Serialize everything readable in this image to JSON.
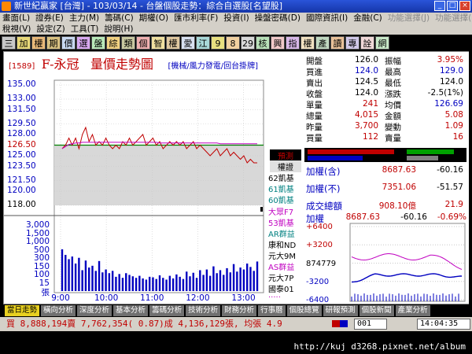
{
  "window": {
    "title": "新世紀贏家 [台灣] - 103/03/14 - 台盤個股走勢：綜合自選股[名望股]"
  },
  "menu": {
    "row1": [
      "畫面(L)",
      "證券(E)",
      "主力(M)",
      "籌碼(C)",
      "期權(O)",
      "匯市利率(F)",
      "投資(I)",
      "操盤密碼(D)",
      "國際資訊(I)",
      "金融(C)",
      "功能選擇(J)",
      "功能選擇(K)"
    ],
    "row2": [
      "稅視(V)",
      "設定(Z)",
      "工具(T)",
      "說明(H)"
    ]
  },
  "toolbar": [
    {
      "t": "三",
      "c": "#c8c8c8"
    },
    {
      "t": "加",
      "c": "#e8d878"
    },
    {
      "t": "權",
      "c": "#e8b878"
    },
    {
      "t": "期",
      "c": "#d8c080"
    },
    {
      "t": "價",
      "c": "#c8d8f0"
    },
    {
      "t": "選",
      "c": "#d8a8f0"
    },
    {
      "t": "盤",
      "c": "#b8e8b8"
    },
    {
      "t": "綜",
      "c": "#f0d080"
    },
    {
      "t": "類",
      "c": "#c8c8a0"
    },
    {
      "t": "個",
      "c": "#f0b0b0"
    },
    {
      "t": "智",
      "c": "#f0e0a0"
    },
    {
      "t": "權",
      "c": "#e0c8a0"
    },
    {
      "t": "愛",
      "c": "#d8e0f0"
    },
    {
      "t": "江",
      "c": "#a8d8d8"
    },
    {
      "t": "9",
      "c": "#e8e080"
    },
    {
      "t": "8",
      "c": "#f0d0a0"
    },
    {
      "t": "29",
      "c": "#d8d8d8"
    },
    {
      "t": "核",
      "c": "#b8e0b8"
    },
    {
      "t": "興",
      "c": "#f0c8c8"
    },
    {
      "t": "指",
      "c": "#d8b8e8"
    },
    {
      "t": "權",
      "c": "#f0e0c0"
    },
    {
      "t": "產",
      "c": "#c0d8c0"
    },
    {
      "t": "讀",
      "c": "#e8c098"
    },
    {
      "t": "專",
      "c": "#d0c8e8"
    },
    {
      "t": "詮",
      "c": "#f0d8d8"
    },
    {
      "t": "網",
      "c": "#c8e8c8"
    }
  ],
  "header": {
    "code": "[1589]",
    "name": "F-永冠",
    "title": "量價走勢圖",
    "modes": "[機械/風力發電/回台掛牌]"
  },
  "price_axis": [
    "135.00",
    "133.00",
    "131.50",
    "129.50",
    "128.00",
    "126.50",
    "125.00",
    "123.50",
    "121.50",
    "120.00",
    "118.00"
  ],
  "volume_axis": [
    "3,000",
    "1,500",
    "1,000",
    "500",
    "300",
    "150",
    "100",
    "15",
    "張"
  ],
  "time_axis": [
    "9:00",
    "10:00",
    "11:00",
    "12:00",
    "13:00"
  ],
  "brokers": [
    {
      "t": "預測",
      "c": "#c00000",
      "bg": "#000"
    },
    {
      "t": "權證",
      "c": "#000",
      "bg": "#e0e0e0"
    },
    {
      "t": "62凱基",
      "c": "#000"
    },
    {
      "t": "61凱基",
      "c": "#008080"
    },
    {
      "t": "60凱基",
      "c": "#008080"
    },
    {
      "t": "大眾F7",
      "c": "#c000c0"
    },
    {
      "t": "53凱基",
      "c": "#c000c0"
    },
    {
      "t": "AR群益",
      "c": "#008080"
    },
    {
      "t": "康和ND",
      "c": "#000"
    },
    {
      "t": "元大9M",
      "c": "#000"
    },
    {
      "t": "AS群益",
      "c": "#c000c0"
    },
    {
      "t": "元大7P",
      "c": "#000"
    },
    {
      "t": "國泰01",
      "c": "#000"
    },
    {
      "t": "·····",
      "c": "#c000c0"
    }
  ],
  "quote": [
    {
      "l1": "開盤",
      "v1": "126.0",
      "c1": "#000",
      "l2": "振幅",
      "v2": "3.95%",
      "c2": "#c00000"
    },
    {
      "l1": "買進",
      "v1": "124.0",
      "c1": "#0000c0",
      "l2": "最高",
      "v2": "129.0",
      "c2": "#0000c0"
    },
    {
      "l1": "賣出",
      "v1": "124.5",
      "c1": "#000",
      "l2": "最低",
      "v2": "124.0",
      "c2": "#000"
    },
    {
      "l1": "收盤",
      "v1": "124.0",
      "c1": "#000",
      "l2": "漲跌",
      "v2": "-2.5(1%)",
      "c2": "#000"
    },
    {
      "l1": "單量",
      "v1": "241",
      "c1": "#c00000",
      "l2": "均價",
      "v2": "126.69",
      "c2": "#0000c0"
    },
    {
      "l1": "總量",
      "v1": "4,015",
      "c1": "#c00000",
      "l2": "金額",
      "v2": "5.08",
      "c2": "#c00000"
    },
    {
      "l1": "昨量",
      "v1": "3,700",
      "c1": "#c00000",
      "l2": "變動",
      "v2": "1.09",
      "c2": "#c00000"
    },
    {
      "l1": "買量",
      "v1": "112",
      "c1": "#c00000",
      "l2": "賣量",
      "v2": "16",
      "c2": "#c00000"
    }
  ],
  "market": [
    {
      "l": "加權(含)",
      "v": "8687.63",
      "d": "-60.16"
    },
    {
      "l": "加權(不)",
      "v": "7351.06",
      "d": "-51.57"
    },
    {
      "l": "成交總額",
      "v": "908.10億",
      "d": "21.9"
    }
  ],
  "mini": {
    "label": "加權",
    "value": "8687.63",
    "change": "-60.16",
    "pct": "-0.69%",
    "axis": [
      "+6400",
      "+3200",
      "874779",
      "-3200",
      "-6400"
    ]
  },
  "tabs": [
    {
      "t": "當日走勢",
      "active": true
    },
    {
      "t": "橫向分析"
    },
    {
      "t": "深度分析"
    },
    {
      "t": "基本分析"
    },
    {
      "t": "籌碼分析"
    },
    {
      "t": "技術分析"
    },
    {
      "t": "財務分析"
    },
    {
      "t": "行事曆"
    },
    {
      "t": "個股總覽"
    },
    {
      "t": "研報預測"
    },
    {
      "t": "個股新聞"
    },
    {
      "t": "產業分析"
    }
  ],
  "status": {
    "text": "買 8,888,194賣 7,762,354( 0.87)成 4,136,129張, 均張 4.9",
    "box": "001",
    "time": "14:04:35"
  },
  "watermark": "http://kuj d3268.pixnet.net/album",
  "colors": {
    "up": "#c00000",
    "down": "#0000c0",
    "avg": "#c000c0",
    "prev": "#008000"
  },
  "chart_data": {
    "type": "line",
    "title": "量價走勢圖",
    "x_labels": [
      "9:00",
      "10:00",
      "11:00",
      "12:00",
      "13:00"
    ],
    "prev_close": 126.5,
    "ylim": [
      118,
      135
    ],
    "price": [
      126.0,
      126.5,
      127.5,
      126.5,
      127.5,
      126.0,
      128.0,
      129.0,
      127.0,
      128.0,
      126.5,
      127.0,
      126.5,
      127.5,
      126.5,
      126.0,
      126.5,
      126.0,
      127.0,
      126.5,
      127.5,
      126.5,
      127.0,
      127.5,
      128.0,
      126.5,
      127.0,
      127.5,
      126.5,
      127.0,
      126.0,
      126.5,
      127.0,
      126.5,
      127.0,
      126.5,
      127.0,
      126.0,
      126.5,
      127.0,
      126.0,
      126.5,
      126.0,
      125.5,
      125.0,
      125.5,
      126.0,
      125.0,
      125.5,
      126.0,
      125.0,
      125.5,
      125.0,
      124.5,
      125.0,
      124.0,
      124.5,
      124.0,
      124.0
    ],
    "avg": [
      126.0,
      126.3,
      126.6,
      126.7,
      126.8,
      126.8,
      126.9,
      126.9,
      126.9,
      126.9,
      126.9,
      126.9,
      126.9,
      126.9,
      126.9,
      126.9,
      126.9,
      126.9,
      126.9,
      126.9,
      126.9,
      126.9,
      126.9,
      126.9,
      126.9,
      126.9,
      126.9,
      126.9,
      126.9,
      126.8,
      126.8,
      126.8,
      126.8,
      126.8,
      126.8,
      126.8,
      126.8,
      126.8,
      126.8,
      126.8,
      126.8,
      126.8,
      126.8,
      126.8,
      126.8,
      126.8,
      126.8,
      126.7,
      126.7,
      126.7,
      126.7,
      126.7,
      126.7,
      126.7,
      126.7,
      126.7,
      126.7,
      126.7,
      126.69
    ],
    "volume": [
      1200,
      900,
      700,
      820,
      520,
      760,
      300,
      640,
      380,
      440,
      280,
      620,
      240,
      320,
      220,
      280,
      140,
      200,
      120,
      220,
      180,
      150,
      120,
      160,
      110,
      90,
      140,
      130,
      100,
      170,
      120,
      90,
      160,
      110,
      190,
      140,
      100,
      260,
      150,
      230,
      120,
      300,
      180,
      320,
      160,
      420,
      220,
      300,
      180,
      360,
      240,
      500,
      260,
      380,
      320,
      520,
      400,
      280,
      600
    ]
  }
}
